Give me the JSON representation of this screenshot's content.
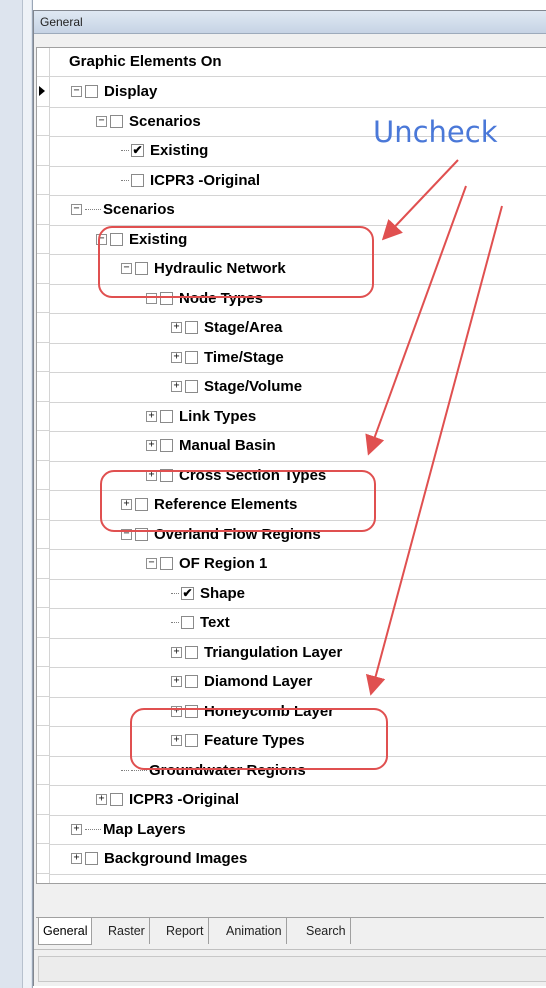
{
  "panel": {
    "title": "General"
  },
  "tree": {
    "header": "Graphic Elements On",
    "rows": [
      {
        "label": "Display",
        "expander": "−",
        "checkbox": "",
        "selected": true
      },
      {
        "label": "Scenarios",
        "expander": "−",
        "checkbox": ""
      },
      {
        "label": "Existing",
        "expander": "",
        "checkbox": "✔"
      },
      {
        "label": "ICPR3 -Original",
        "expander": "",
        "checkbox": ""
      },
      {
        "label": "Scenarios",
        "expander": "−",
        "checkbox": null
      },
      {
        "label": "Existing",
        "expander": "−",
        "checkbox": ""
      },
      {
        "label": "Hydraulic Network",
        "expander": "−",
        "checkbox": ""
      },
      {
        "label": "Node Types",
        "expander": "−",
        "checkbox": ""
      },
      {
        "label": "Stage/Area",
        "expander": "+",
        "checkbox": ""
      },
      {
        "label": "Time/Stage",
        "expander": "+",
        "checkbox": ""
      },
      {
        "label": "Stage/Volume",
        "expander": "+",
        "checkbox": ""
      },
      {
        "label": "Link Types",
        "expander": "+",
        "checkbox": ""
      },
      {
        "label": "Manual Basin",
        "expander": "+",
        "checkbox": ""
      },
      {
        "label": "Cross Section Types",
        "expander": "+",
        "checkbox": ""
      },
      {
        "label": "Reference Elements",
        "expander": "+",
        "checkbox": ""
      },
      {
        "label": "Overland Flow Regions",
        "expander": "−",
        "checkbox": ""
      },
      {
        "label": "OF Region 1",
        "expander": "−",
        "checkbox": ""
      },
      {
        "label": "Shape",
        "expander": "",
        "checkbox": "✔"
      },
      {
        "label": "Text",
        "expander": "",
        "checkbox": ""
      },
      {
        "label": "Triangulation Layer",
        "expander": "+",
        "checkbox": ""
      },
      {
        "label": "Diamond Layer",
        "expander": "+",
        "checkbox": ""
      },
      {
        "label": "Honeycomb Layer",
        "expander": "+",
        "checkbox": ""
      },
      {
        "label": "Feature Types",
        "expander": "+",
        "checkbox": ""
      },
      {
        "label": "Groundwater Regions",
        "expander": "",
        "checkbox": null
      },
      {
        "label": "ICPR3 -Original",
        "expander": "+",
        "checkbox": ""
      },
      {
        "label": "Map Layers",
        "expander": "+",
        "checkbox": null
      },
      {
        "label": "Background Images",
        "expander": "+",
        "checkbox": ""
      }
    ]
  },
  "tabs": [
    "General",
    "Raster",
    "Report",
    "Animation",
    "Search"
  ],
  "annotation": {
    "text": "Uncheck",
    "text_color": "#4a78d8",
    "highlight_color": "#e05050"
  }
}
